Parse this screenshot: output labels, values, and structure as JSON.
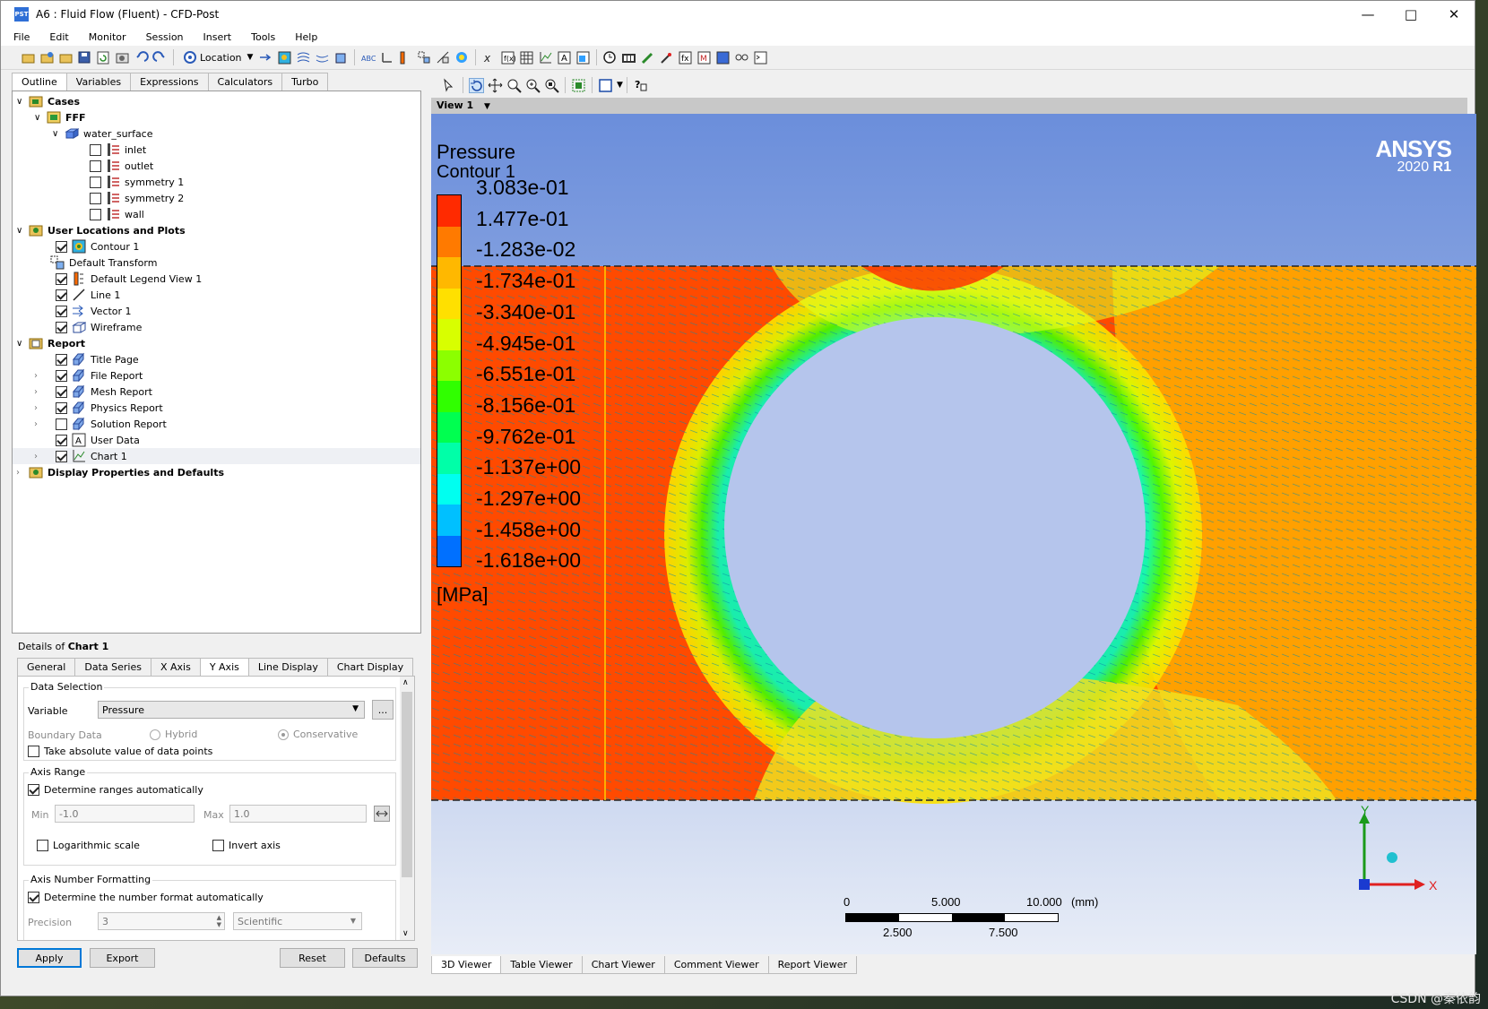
{
  "window": {
    "icon_text": "PST",
    "title": "A6 : Fluid Flow (Fluent) - CFD-Post"
  },
  "menu": [
    "File",
    "Edit",
    "Monitor",
    "Session",
    "Insert",
    "Tools",
    "Help"
  ],
  "toolbar": {
    "location_label": "Location"
  },
  "outline_tabs": [
    "Outline",
    "Variables",
    "Expressions",
    "Calculators",
    "Turbo"
  ],
  "tree": [
    {
      "label": "Cases",
      "bold": true
    },
    {
      "label": "FFF",
      "bold": true
    },
    {
      "label": "water_surface"
    },
    {
      "label": "inlet"
    },
    {
      "label": "outlet"
    },
    {
      "label": "symmetry 1"
    },
    {
      "label": "symmetry 2"
    },
    {
      "label": "wall"
    },
    {
      "label": "User Locations and Plots",
      "bold": true
    },
    {
      "label": "Contour 1"
    },
    {
      "label": "Default Transform"
    },
    {
      "label": "Default Legend View 1"
    },
    {
      "label": "Line 1"
    },
    {
      "label": "Vector 1"
    },
    {
      "label": "Wireframe"
    },
    {
      "label": "Report",
      "bold": true
    },
    {
      "label": "Title Page"
    },
    {
      "label": "File Report"
    },
    {
      "label": "Mesh Report"
    },
    {
      "label": "Physics Report"
    },
    {
      "label": "Solution Report"
    },
    {
      "label": "User Data"
    },
    {
      "label": "Chart 1"
    },
    {
      "label": "Display Properties and Defaults",
      "bold": true
    }
  ],
  "details": {
    "title_prefix": "Details of ",
    "title_object": "Chart 1",
    "tabs": [
      "General",
      "Data Series",
      "X Axis",
      "Y Axis",
      "Line Display",
      "Chart Display"
    ],
    "active_tab": "Y Axis",
    "data_selection": {
      "group": "Data Selection",
      "variable_label": "Variable",
      "variable_value": "Pressure",
      "more_button": "...",
      "boundary_label": "Boundary Data",
      "hybrid": "Hybrid",
      "conservative": "Conservative",
      "absolute_label": "Take absolute value of data points"
    },
    "axis_range": {
      "group": "Axis Range",
      "auto_label": "Determine ranges automatically",
      "min_label": "Min",
      "min_value": "-1.0",
      "max_label": "Max",
      "max_value": "1.0",
      "log_label": "Logarithmic scale",
      "invert_label": "Invert axis"
    },
    "number_format": {
      "group": "Axis Number Formatting",
      "auto_label": "Determine the number format automatically",
      "precision_label": "Precision",
      "precision_value": "3",
      "format_value": "Scientific"
    },
    "buttons": {
      "apply": "Apply",
      "export": "Export",
      "reset": "Reset",
      "defaults": "Defaults"
    }
  },
  "viewer": {
    "view_label": "View 1",
    "legend": {
      "title": "Pressure",
      "subtitle": "Contour 1",
      "values": [
        "3.083e-01",
        "1.477e-01",
        "-1.283e-02",
        "-1.734e-01",
        "-3.340e-01",
        "-4.945e-01",
        "-6.551e-01",
        "-8.156e-01",
        "-9.762e-01",
        "-1.137e+00",
        "-1.297e+00",
        "-1.458e+00",
        "-1.618e+00"
      ],
      "colors": [
        "#ff2a00",
        "#ff7a00",
        "#ffb800",
        "#ffe000",
        "#d8ff00",
        "#8cff00",
        "#30ff00",
        "#00ff50",
        "#00ffa8",
        "#00fff0",
        "#00c0ff",
        "#0070ff",
        "#0020ff"
      ],
      "unit": "[MPa]"
    },
    "brand": {
      "name": "ANSYS",
      "version": "2020",
      "release": "R1"
    },
    "axes": {
      "y": "Y",
      "x": "X"
    },
    "scale": {
      "top": [
        "0",
        "5.000",
        "10.000"
      ],
      "unit": "(mm)",
      "bottom": [
        "2.500",
        "7.500"
      ]
    }
  },
  "bottom_tabs": [
    "3D Viewer",
    "Table Viewer",
    "Chart Viewer",
    "Comment Viewer",
    "Report Viewer"
  ],
  "watermark": "CSDN @秦依韵"
}
